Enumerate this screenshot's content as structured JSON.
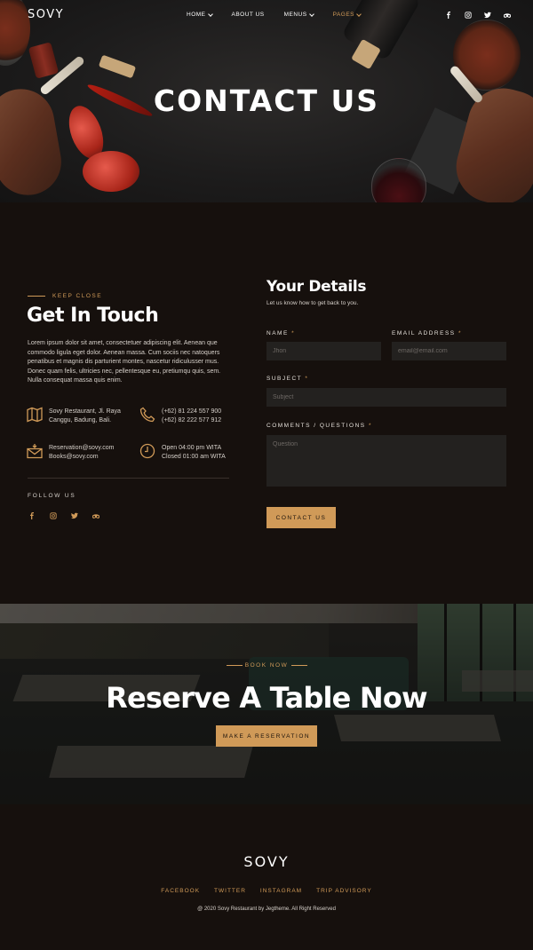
{
  "brand": {
    "logo": "SOVY",
    "accent": "#d09a58"
  },
  "nav": {
    "items": [
      {
        "label": "HOME",
        "dropdown": true,
        "active": false
      },
      {
        "label": "ABOUT US",
        "dropdown": false,
        "active": false
      },
      {
        "label": "MENUS",
        "dropdown": true,
        "active": false
      },
      {
        "label": "PAGES",
        "dropdown": true,
        "active": true
      }
    ],
    "social": [
      "facebook-icon",
      "instagram-icon",
      "twitter-icon",
      "tripadvisor-icon"
    ]
  },
  "hero": {
    "title": "CONTACT US"
  },
  "contact": {
    "kicker": "KEEP CLOSE",
    "title": "Get In Touch",
    "body": "Lorem ipsum dolor sit amet, consectetuer adipiscing elit. Aenean que commodo ligula eget dolor. Aenean massa. Cum sociis nec natoquers penatibus et magnis dis parturient montes, nascetur ridiculusser mus. Donec quam felis, ultricies nec, pellentesque eu, pretiumqu quis, sem. Nulla consequat massa quis enim.",
    "address": {
      "line1": "Sovy Restaurant, Jl. Raya",
      "line2": "Canggu, Badung, Bali."
    },
    "phone": {
      "line1": "(+62) 81 224 557 900",
      "line2": "(+62) 82 222 577 912"
    },
    "email": {
      "line1": "Reservation@sovy.com",
      "line2": "Books@sovy.com"
    },
    "hours": {
      "line1": "Open 04:00 pm WITA",
      "line2": "Closed 01:00 am WITA"
    },
    "follow_label": "FOLLOW US"
  },
  "form": {
    "title": "Your Details",
    "subtitle": "Let us know how to get back to you.",
    "name_label": "NAME",
    "name_placeholder": "Jhon",
    "email_label": "EMAIL ADDRESS",
    "email_placeholder": "email@email.com",
    "subject_label": "SUBJECT",
    "subject_placeholder": "Subject",
    "comments_label": "COMMENTS / QUESTIONS",
    "comments_placeholder": "Question",
    "required_mark": "*",
    "submit_label": "CONTACT US"
  },
  "reserve": {
    "kicker": "BOOK NOW",
    "title": "Reserve A Table Now",
    "button_label": "MAKE A RESERVATION"
  },
  "footer": {
    "logo": "SOVY",
    "links": [
      "FACEBOOK",
      "TWITTER",
      "INSTAGRAM",
      "TRIP ADVISORY"
    ],
    "copyright": "@ 2020 Sovy Restaurant by Jegtheme. All Right Reserved"
  }
}
